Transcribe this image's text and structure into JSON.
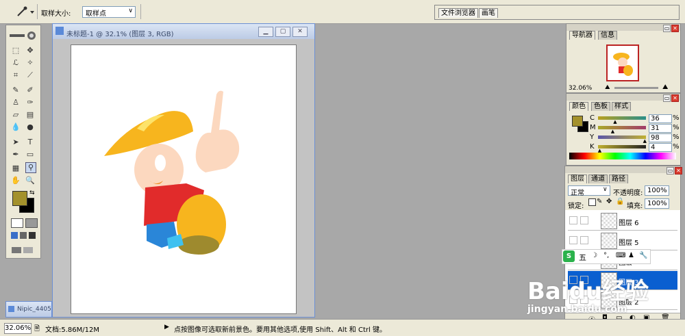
{
  "options_bar": {
    "sample_size_label": "取样大小:",
    "sample_size_value": "取样点",
    "tabs": [
      "文件浏览器",
      "画笔"
    ]
  },
  "document": {
    "title": "未标题-1 @ 32.1% (图层 3, RGB)",
    "minimized_title": "Nipic_4405"
  },
  "navigator": {
    "tabs": [
      "导航器",
      "信息"
    ],
    "zoom": "32.06%"
  },
  "color_panel": {
    "tabs": [
      "颜色",
      "色板",
      "样式"
    ],
    "channels": [
      {
        "label": "C",
        "value": "36",
        "unit": "%"
      },
      {
        "label": "M",
        "value": "31",
        "unit": "%"
      },
      {
        "label": "Y",
        "value": "98",
        "unit": "%"
      },
      {
        "label": "K",
        "value": "4",
        "unit": "%"
      }
    ],
    "foreground": "#a3912c",
    "background": "#000000"
  },
  "layers_panel": {
    "tabs": [
      "图层",
      "通道",
      "路径"
    ],
    "blend_mode": "正常",
    "opacity_label": "不透明度:",
    "opacity_value": "100%",
    "lock_label": "锁定:",
    "fill_label": "填充:",
    "fill_value": "100%",
    "layers": [
      "图层 6",
      "图层 5",
      "图层",
      "图层 3",
      "图层 2"
    ]
  },
  "ime_bar": {
    "label": "五"
  },
  "status_bar": {
    "zoom": "32.06%",
    "doc_info": "文档:5.86M/12M",
    "hint": "点按图像可选取新前景色。要用其他选项,使用 Shift、Alt 和 Ctrl 键。"
  },
  "watermark": {
    "brand": "Baidu经验",
    "url": "jingyan.baidu.com"
  }
}
